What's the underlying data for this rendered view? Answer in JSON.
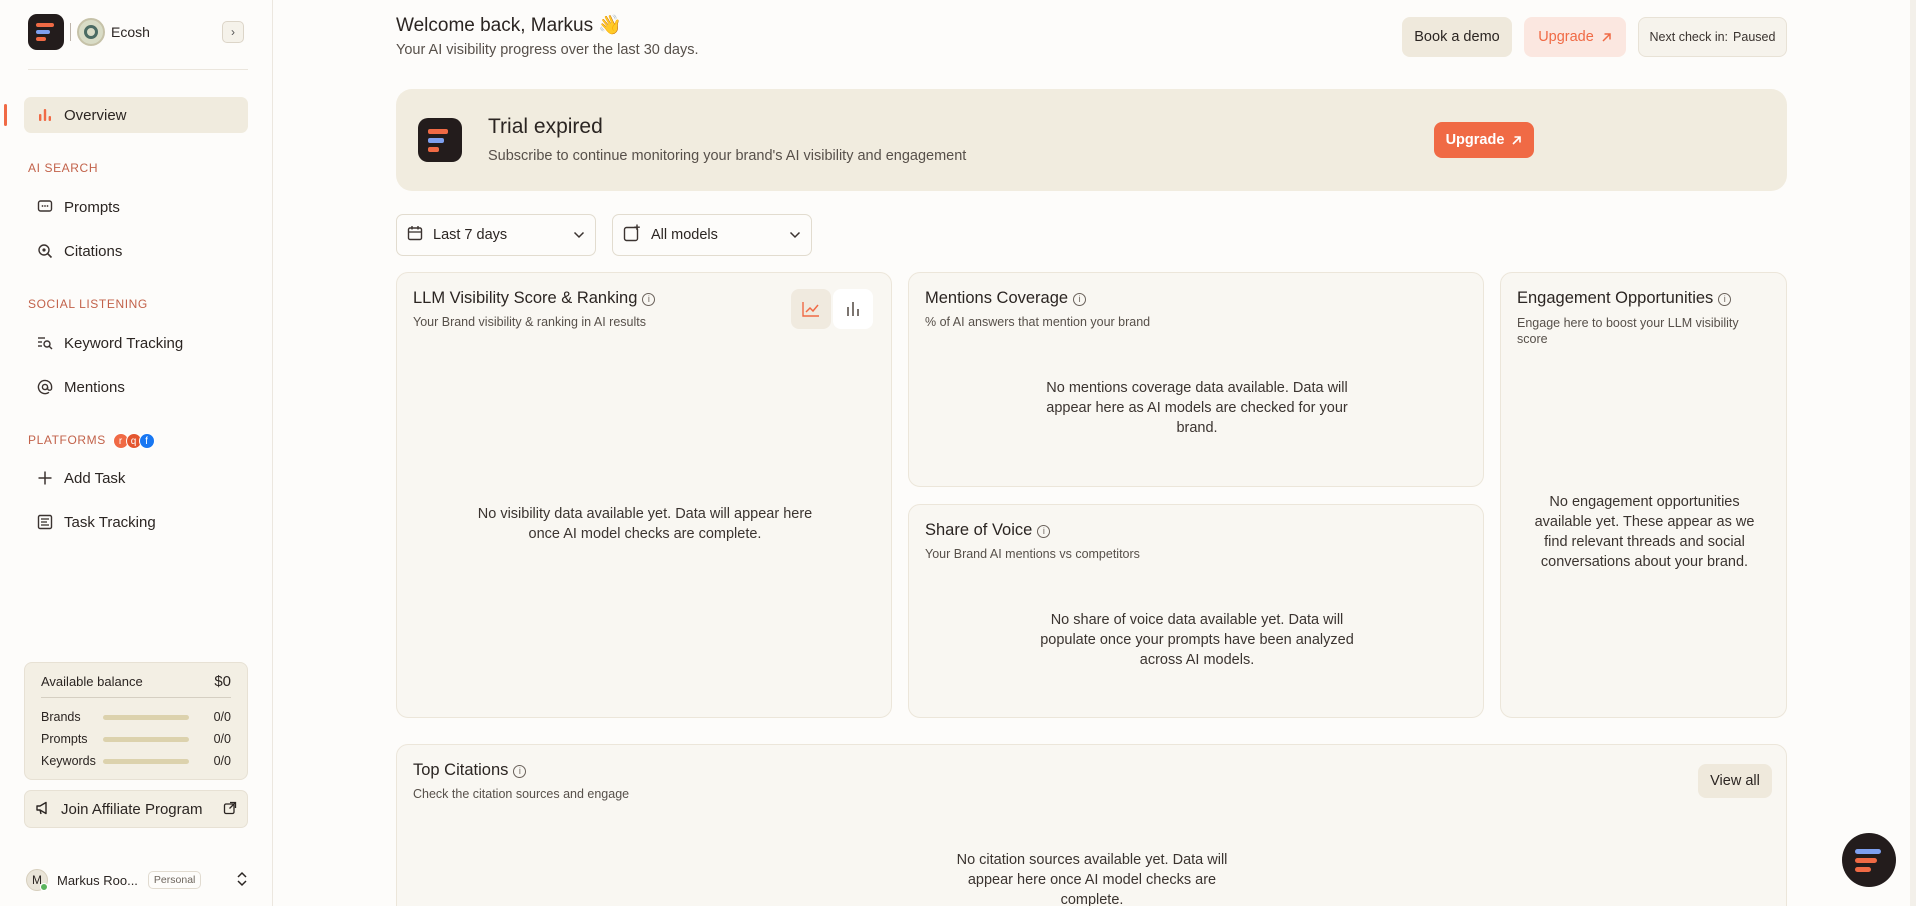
{
  "sidebar": {
    "brand_name": "Ecosh",
    "nav": {
      "overview": "Overview",
      "ai_search_label": "AI SEARCH",
      "prompts": "Prompts",
      "citations": "Citations",
      "social_label": "SOCIAL LISTENING",
      "keyword_tracking": "Keyword Tracking",
      "mentions": "Mentions",
      "platforms_label": "PLATFORMS",
      "add_task": "Add Task",
      "task_tracking": "Task Tracking"
    },
    "balance": {
      "label": "Available balance",
      "amount": "$0",
      "rows": [
        {
          "label": "Brands",
          "value": "0/0"
        },
        {
          "label": "Prompts",
          "value": "0/0"
        },
        {
          "label": "Keywords",
          "value": "0/0"
        }
      ]
    },
    "affiliate": "Join Affiliate Program",
    "user": {
      "initial": "M",
      "name": "Markus Roo...",
      "plan": "Personal"
    }
  },
  "header": {
    "welcome": "Welcome back, Markus 👋",
    "subtitle": "Your AI visibility progress over the last 30 days.",
    "book_demo": "Book a demo",
    "upgrade": "Upgrade",
    "next_check_label": "Next check in:",
    "next_check_value": "Paused"
  },
  "trial": {
    "title": "Trial expired",
    "subtitle": "Subscribe to continue monitoring your brand's AI visibility and engagement",
    "upgrade": "Upgrade"
  },
  "filters": {
    "date_range": "Last 7 days",
    "models": "All models"
  },
  "cards": {
    "visibility": {
      "title": "LLM Visibility Score & Ranking",
      "subtitle": "Your Brand visibility & ranking in AI results",
      "empty": "No visibility data available yet. Data will appear here once AI model checks are complete."
    },
    "mentions": {
      "title": "Mentions Coverage",
      "subtitle": "% of AI answers that mention your brand",
      "empty": "No mentions coverage data available. Data will appear here as AI models are checked for your brand."
    },
    "share": {
      "title": "Share of Voice",
      "subtitle": "Your Brand AI mentions vs competitors",
      "empty": "No share of voice data available yet. Data will populate once your prompts have been analyzed across AI models."
    },
    "engagement": {
      "title": "Engagement Opportunities",
      "subtitle": "Engage here to boost your LLM visibility score",
      "empty": "No engagement opportunities available yet. These appear as we find relevant threads and social conversations about your brand."
    },
    "citations": {
      "title": "Top Citations",
      "subtitle": "Check the citation sources and engage",
      "view_all": "View all",
      "empty": "No citation sources available yet. Data will appear here once AI model checks are complete."
    }
  },
  "colors": {
    "accent": "#f06a45",
    "panel": "#f1ecdf",
    "dark": "#231c1c"
  },
  "icons": [
    "chevron-right-icon",
    "bar-chart-icon",
    "message-square-icon",
    "search-citation-icon",
    "keyword-search-icon",
    "at-sign-icon",
    "plus-icon",
    "task-list-icon",
    "megaphone-icon",
    "external-link-icon",
    "chevrons-up-down-icon",
    "calendar-icon",
    "add-model-icon",
    "chevron-down-icon",
    "info-icon",
    "line-chart-icon",
    "arrow-up-right-icon"
  ]
}
